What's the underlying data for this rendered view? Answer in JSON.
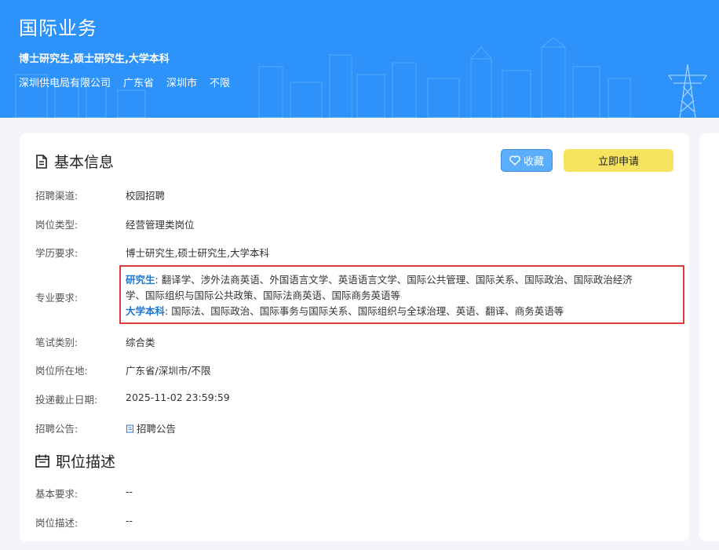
{
  "banner": {
    "title": "国际业务",
    "education": "博士研究生,硕士研究生,大学本科",
    "company": "深圳供电局有限公司",
    "province": "广东省",
    "city": "深圳市",
    "district": "不限"
  },
  "basic": {
    "heading": "基本信息",
    "favorite_label": "收藏",
    "apply_label": "立即申请",
    "rows": {
      "channel": {
        "label": "招聘渠道:",
        "value": "校园招聘"
      },
      "type": {
        "label": "岗位类型:",
        "value": "经营管理类岗位"
      },
      "education": {
        "label": "学历要求:",
        "value": "博士研究生,硕士研究生,大学本科"
      },
      "major": {
        "label": "专业要求:"
      },
      "exam": {
        "label": "笔试类别:",
        "value": "综合类"
      },
      "location": {
        "label": "岗位所在地:",
        "value": "广东省/深圳市/不限"
      },
      "deadline": {
        "label": "投递截止日期:",
        "value": "2025-11-02 23:59:59"
      },
      "notice": {
        "label": "招聘公告:",
        "value": "招聘公告"
      }
    },
    "major_req": {
      "grad_label": "研究生",
      "grad_sep": ":",
      "grad_line1": "翻译学、涉外法商英语、外国语言文学、英语语言文学、国际公共管理、国际关系、国际政治、国际政治经济",
      "grad_line2": "学、国际组织与国际公共政策、国际法商英语、国际商务英语等",
      "ug_label": "大学本科",
      "ug_sep": ":",
      "ug_text": "国际法、国际政治、国际事务与国际关系、国际组织与全球治理、英语、翻译、商务英语等"
    }
  },
  "description": {
    "heading": "职位描述",
    "rows": {
      "basic_req": {
        "label": "基本要求:",
        "value": "--"
      },
      "duty": {
        "label": "岗位描述:",
        "value": "--"
      }
    }
  },
  "colors": {
    "banner": "#2d93fb",
    "favorite": "#5aaefc",
    "apply": "#f5e35f",
    "highlight_border": "#e23b3b",
    "major_level": "#1a78d9",
    "link": "#2f83d8"
  },
  "icons": [
    "document-icon",
    "heart-icon",
    "calendar-icon",
    "link-doc-icon",
    "power-tower-icon",
    "cityscape-icon"
  ]
}
